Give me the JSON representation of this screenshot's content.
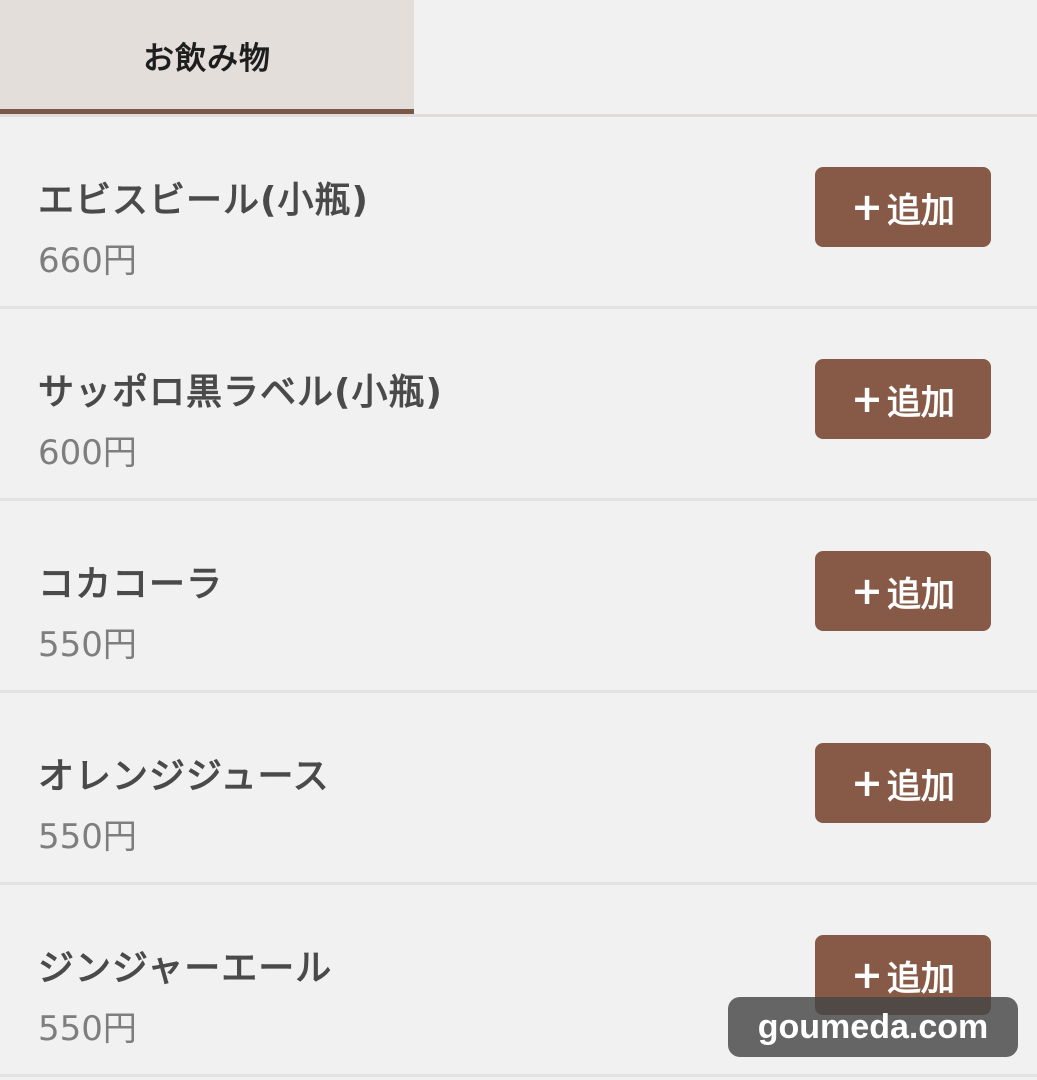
{
  "tabs": [
    {
      "label": "お飲み物",
      "active": true
    }
  ],
  "items": [
    {
      "name": "エビスビール(小瓶)",
      "price": "660円",
      "add_label": "追加"
    },
    {
      "name": "サッポロ黒ラベル(小瓶)",
      "price": "600円",
      "add_label": "追加"
    },
    {
      "name": "コカコーラ",
      "price": "550円",
      "add_label": "追加"
    },
    {
      "name": "オレンジジュース",
      "price": "550円",
      "add_label": "追加"
    },
    {
      "name": "ジンジャーエール",
      "price": "550円",
      "add_label": "追加"
    }
  ],
  "add_icon": "plus-icon",
  "watermark": "goumeda.com",
  "colors": {
    "accent": "#875a47",
    "tab_active_bg": "#e4dedb",
    "tab_underline": "#7a5849",
    "background": "#f2f1f2"
  }
}
